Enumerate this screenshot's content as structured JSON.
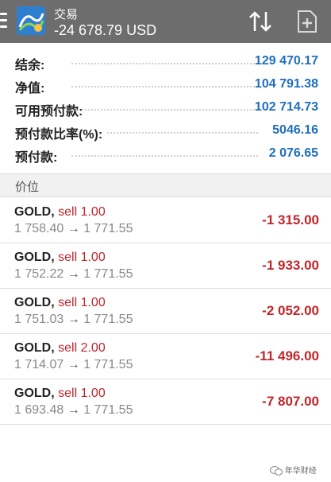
{
  "header": {
    "title": "交易",
    "balance": "-24 678.79 USD",
    "icons": [
      "menu-icon",
      "metatrader-logo",
      "sort-icon",
      "new-order-icon"
    ]
  },
  "summary": [
    {
      "label": "结余:",
      "value": "129 470.17"
    },
    {
      "label": "净值:",
      "value": "104 791.38"
    },
    {
      "label": "可用预付款:",
      "value": "102 714.73"
    },
    {
      "label": "预付款比率(%):",
      "value": "5046.16"
    },
    {
      "label": "预付款:",
      "value": "2 076.65"
    }
  ],
  "section_title": "价位",
  "trades": [
    {
      "symbol": "GOLD,",
      "side": "sell 1.00",
      "open": "1 758.40",
      "arrow": "→",
      "current": "1 771.55",
      "profit": "-1 315.00"
    },
    {
      "symbol": "GOLD,",
      "side": "sell 1.00",
      "open": "1 752.22",
      "arrow": "→",
      "current": "1 771.55",
      "profit": "-1 933.00"
    },
    {
      "symbol": "GOLD,",
      "side": "sell 1.00",
      "open": "1 751.03",
      "arrow": "→",
      "current": "1 771.55",
      "profit": "-2 052.00"
    },
    {
      "symbol": "GOLD,",
      "side": "sell 2.00",
      "open": "1 714.07",
      "arrow": "→",
      "current": "1 771.55",
      "profit": "-11 496.00"
    },
    {
      "symbol": "GOLD,",
      "side": "sell 1.00",
      "open": "1 693.48",
      "arrow": "→",
      "current": "1 771.55",
      "profit": "-7 807.00"
    }
  ],
  "watermark": "年华财经",
  "colors": {
    "topbar": "#6d6d6d",
    "value_blue": "#1f6fbd",
    "loss_red": "#c1262b"
  }
}
